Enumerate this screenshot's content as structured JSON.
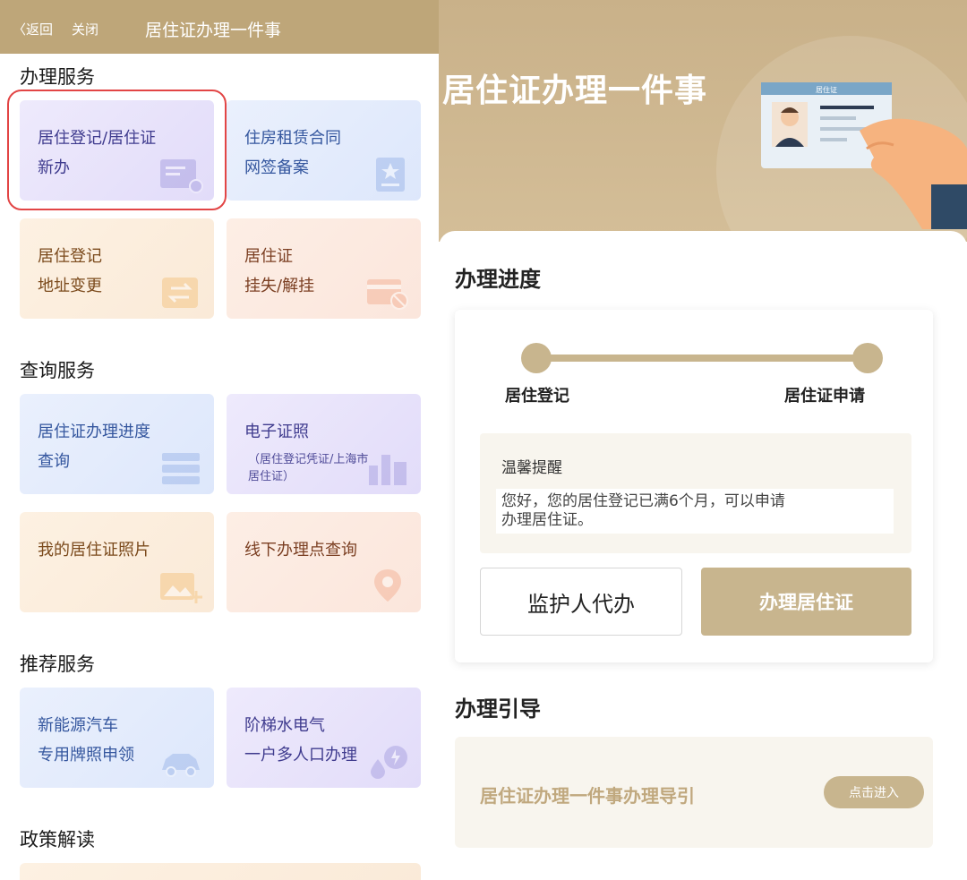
{
  "left": {
    "topbar": {
      "back": "〈返回",
      "close": "关闭",
      "title": "居住证办理一件事"
    },
    "sections": {
      "handle": "办理服务",
      "query": "查询服务",
      "recommend": "推荐服务",
      "policy": "政策解读"
    },
    "cards": {
      "c1": {
        "l1": "居住登记/居住证",
        "l2": "新办"
      },
      "c2": {
        "l1": "住房租赁合同",
        "l2": "网签备案"
      },
      "c3": {
        "l1": "居住登记",
        "l2": "地址变更"
      },
      "c4": {
        "l1": "居住证",
        "l2": "挂失/解挂"
      },
      "c5": {
        "l1": "居住证办理进度",
        "l2": "查询"
      },
      "c6": {
        "l1": "电子证照",
        "sub1": "（居住登记凭证/上海市",
        "sub2": "居住证）"
      },
      "c7": {
        "l1": "我的居住证照片"
      },
      "c8": {
        "l1": "线下办理点查询"
      },
      "c9": {
        "l1": "新能源汽车",
        "l2": "专用牌照申领"
      },
      "c10": {
        "l1": "阶梯水电气",
        "l2": "一户多人口办理"
      }
    },
    "highlight_color": "#e24545"
  },
  "right": {
    "banner": {
      "title": "居住证办理一件事",
      "card_label": "居住证"
    },
    "progress": {
      "title": "办理进度",
      "step1": "居住登记",
      "step2": "居住证申请",
      "tip_title": "温馨提醒",
      "tip_line1": "您好，您的居住登记已满6个月，可以申请",
      "tip_line2": "办理居住证。",
      "btn_guardian": "监护人代办",
      "btn_apply": "办理居住证"
    },
    "guide": {
      "title": "办理引导",
      "item": "居住证办理一件事办理导引",
      "enter": "点击进入"
    },
    "colors": {
      "gold": "#c8b58e",
      "banner": "#c9b189"
    }
  }
}
